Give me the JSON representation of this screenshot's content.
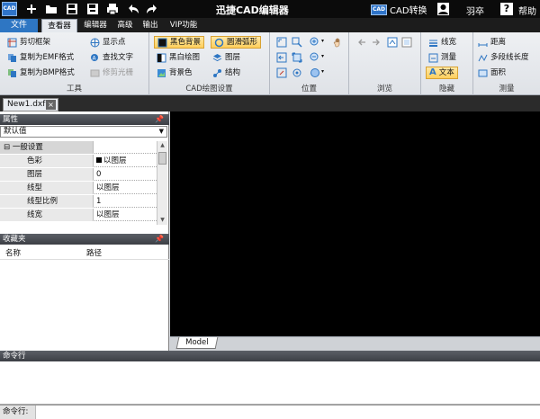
{
  "titlebar": {
    "app_icon": "CAD",
    "title": "迅捷CAD编辑器",
    "cad_badge": "CAD",
    "cad_convert": "CAD转换",
    "username": "羽卒",
    "help_icon": "?",
    "help": "帮助"
  },
  "menu": {
    "file": "文件",
    "tabs": [
      "查看器",
      "编辑器",
      "高级",
      "输出",
      "VIP功能"
    ]
  },
  "ribbon": {
    "tools": {
      "label": "工具",
      "items": [
        "剪切框架",
        "复制为EMF格式",
        "复制为BMP格式",
        "显示点",
        "查找文字",
        "修剪光栅"
      ]
    },
    "cad_settings": {
      "label": "CAD绘图设置",
      "items": [
        "黑色背景",
        "黑白绘图",
        "背景色",
        "圆滑弧形",
        "图层",
        "结构"
      ]
    },
    "position": {
      "label": "位置"
    },
    "browse": {
      "label": "浏览"
    },
    "hide": {
      "label": "隐藏",
      "items": [
        "线宽",
        "测量",
        "文本"
      ]
    },
    "measure": {
      "label": "测量",
      "items": [
        "距离",
        "多段线长度",
        "面积"
      ]
    }
  },
  "document": {
    "tab": "New1.dxf",
    "close": "×"
  },
  "properties": {
    "header": "属性",
    "pin": "ꟸ",
    "dropdown_value": "默认值",
    "group": "一般设置",
    "rows": [
      {
        "key": "色彩",
        "value": "以图层"
      },
      {
        "key": "图层",
        "value": "0"
      },
      {
        "key": "线型",
        "value": "以图层"
      },
      {
        "key": "线型比例",
        "value": "1"
      },
      {
        "key": "线宽",
        "value": "以图层"
      }
    ]
  },
  "favorites": {
    "header": "收藏夹",
    "columns": [
      "名称",
      "路径"
    ]
  },
  "canvas": {
    "model_tab": "Model"
  },
  "command": {
    "header": "命令行",
    "label": "命令行:",
    "value": ""
  },
  "colors": {
    "accent": "#2e76c3",
    "canvas": "#000000",
    "titlebar": "#0b0b0b"
  }
}
